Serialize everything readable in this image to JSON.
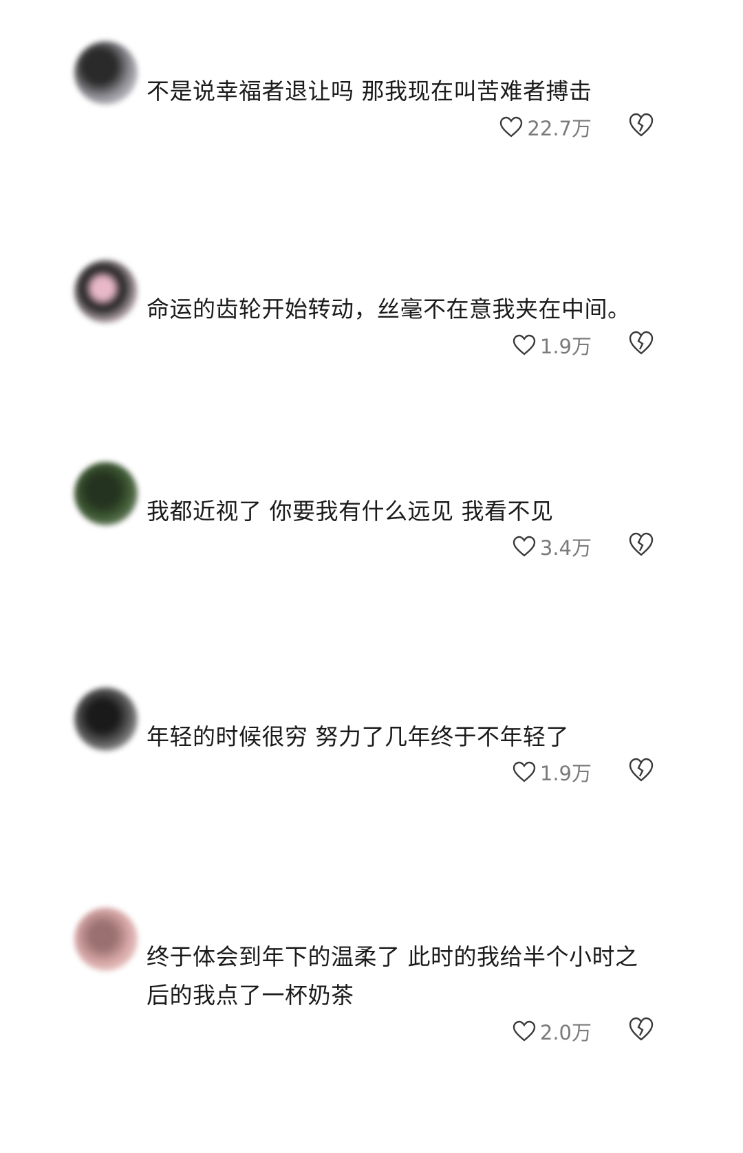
{
  "comments": [
    {
      "text": "不是说幸福者退让吗 那我现在叫苦难者搏击",
      "likes": "22.7万",
      "avatar_colors": [
        "#2a2a2a",
        "#8a8a90",
        "#d8d8de"
      ]
    },
    {
      "text": "命运的齿轮开始转动，丝毫不在意我夹在中间。",
      "likes": "1.9万",
      "avatar_colors": [
        "#1e1e1e",
        "#e8b8c8",
        "#f4e0e8"
      ]
    },
    {
      "text": "我都近视了 你要我有什么远见 我看不见",
      "likes": "3.4万",
      "avatar_colors": [
        "#24331f",
        "#3f5a34",
        "#8d9b88"
      ]
    },
    {
      "text": "年轻的时候很穷 努力了几年终于不年轻了",
      "likes": "1.9万",
      "avatar_colors": [
        "#1a1a1a",
        "#5a5a5a",
        "#bdbdbd"
      ]
    },
    {
      "text": "终于体会到年下的温柔了 此时的我给半个小时之后的我点了一杯奶茶",
      "likes": "2.0万",
      "avatar_colors": [
        "#9a7070",
        "#d8a8a8",
        "#efd8d4"
      ]
    }
  ],
  "icons": {
    "like": "heart-outline-icon",
    "dislike": "broken-heart-icon"
  }
}
